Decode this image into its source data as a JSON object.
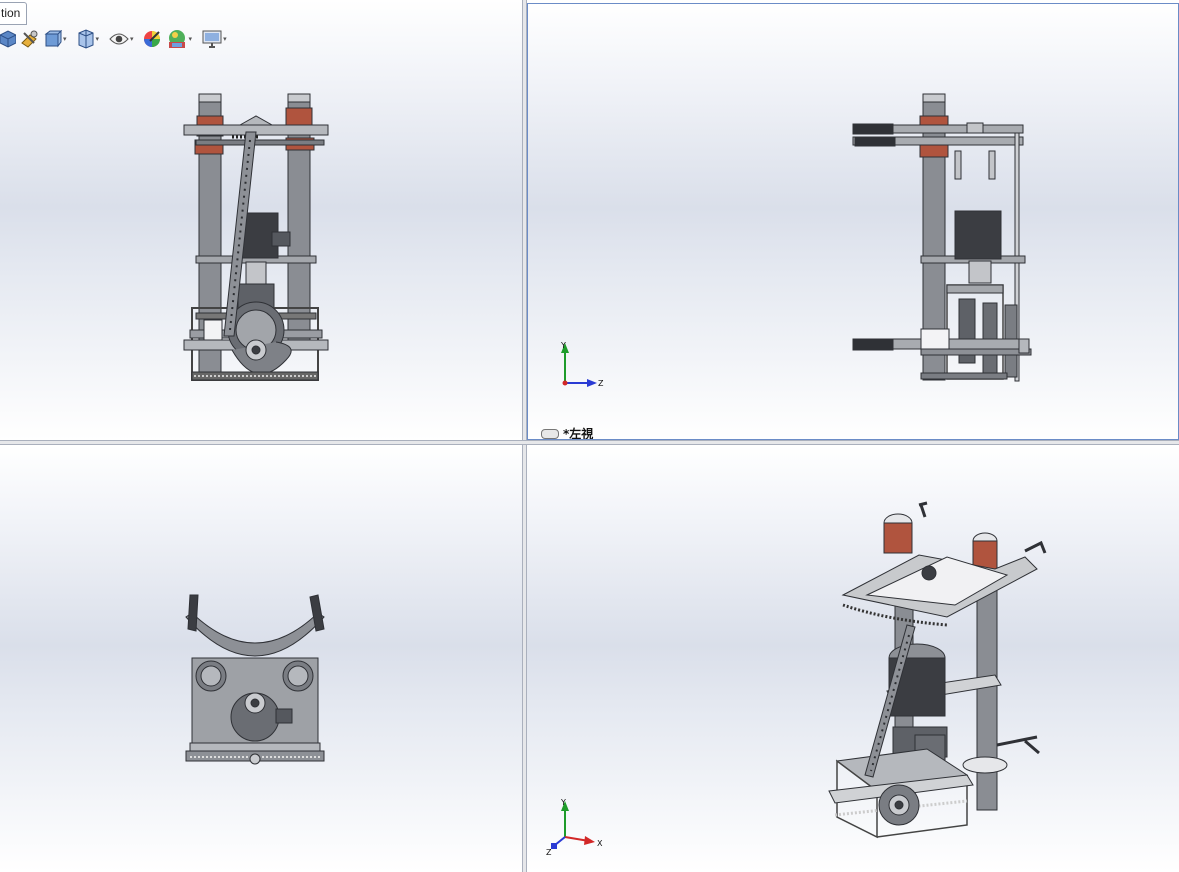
{
  "tab": {
    "label": "tion"
  },
  "toolbar": {
    "items": [
      {
        "name": "view-orientation-icon",
        "dropdown": false
      },
      {
        "name": "section-view-icon",
        "dropdown": false
      },
      {
        "name": "previous-view-icon",
        "dropdown": true
      },
      {
        "name": "display-style-icon",
        "dropdown": true
      },
      {
        "name": "hide-show-items-icon",
        "dropdown": true
      },
      {
        "name": "edit-appearance-icon",
        "dropdown": false
      },
      {
        "name": "apply-scene-icon",
        "dropdown": true
      },
      {
        "name": "view-settings-icon",
        "dropdown": true
      }
    ]
  },
  "viewports": {
    "top_left": {
      "view": "front"
    },
    "top_right": {
      "view": "left",
      "label": "*左視"
    },
    "bottom_left": {
      "view": "top"
    },
    "bottom_right": {
      "view": "isometric"
    }
  },
  "triad_left_view": {
    "y": "Y",
    "z": "Z"
  },
  "triad_iso_view": {
    "y": "Y",
    "x": "X",
    "z": "Z"
  },
  "colors": {
    "metal": "#8d9096",
    "dark_metal": "#3b3d42",
    "copper": "#b0543e",
    "axis_x": "#d22828",
    "axis_y": "#1e9b2a",
    "axis_z": "#2a3bd4",
    "active_border": "#6b8cc7"
  }
}
